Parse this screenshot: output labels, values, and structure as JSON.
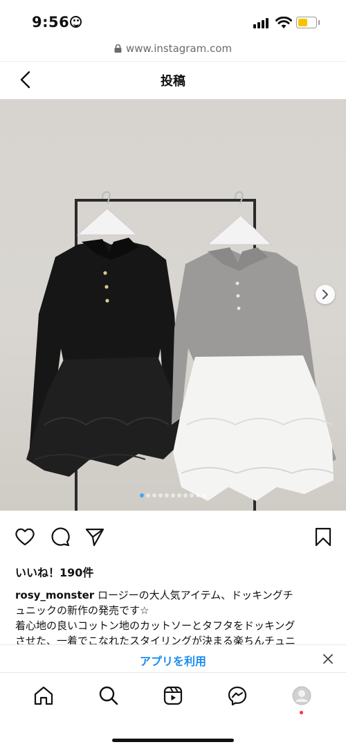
{
  "status_bar": {
    "time": "9:56"
  },
  "browser": {
    "url": "www.instagram.com"
  },
  "header": {
    "title": "投稿"
  },
  "post": {
    "carousel": {
      "total": 11,
      "active_index": 0
    },
    "likes": "いいね！190件",
    "caption": {
      "username": "rosy_monster",
      "text_line1": " ロージーの大人気アイテム、ドッキングチ",
      "line2": "ュニックの新作の発売です☆",
      "line3": "着心地の良いコットン地のカットソーとタフタをドッキング",
      "line4": "させた、一着でこなれたスタイリングが決まる楽ちんチュニ"
    }
  },
  "app_banner": {
    "label": "アプリを利用"
  },
  "colors": {
    "accent": "#1a8cf0",
    "battery": "#f5c400",
    "notification": "#ff3040"
  },
  "icons": {
    "back": "chevron-left-icon",
    "like": "heart-icon",
    "comment": "comment-icon",
    "share": "send-icon",
    "save": "bookmark-icon",
    "home": "home-icon",
    "search": "search-icon",
    "reels": "reels-icon",
    "messenger": "messenger-icon",
    "profile": "profile-icon"
  }
}
